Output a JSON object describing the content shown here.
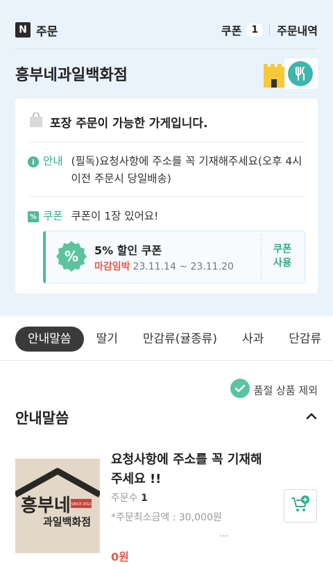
{
  "header": {
    "logo": "N",
    "title": "주문",
    "coupon_label": "쿠폰",
    "coupon_count": "1",
    "history_label": "주문내역"
  },
  "store": {
    "name": "흥부네과일백화점"
  },
  "notice_card": {
    "packaging_text": "포장 주문이 가능한 가게입니다.",
    "info_label": "안내",
    "info_text": "(필독)요청사항에 주소를 꼭 기재해주세요(오후 4시이전 주문시 당일배송)",
    "coupon_label": "쿠폰",
    "coupon_text": "쿠폰이 1장 있어요!"
  },
  "coupon": {
    "name": "5% 할인 쿠폰",
    "urgent": "마감임박",
    "dates": "23.11.14 ~ 23.11.20",
    "use_label_1": "쿠폰",
    "use_label_2": "사용"
  },
  "tabs": [
    "안내말씀",
    "딸기",
    "만감류(귤종류)",
    "사과",
    "단감류"
  ],
  "filter": {
    "soldout_label": "품절 상품 제외"
  },
  "section": {
    "title": "안내말씀"
  },
  "product": {
    "title_line1": "요청사항에 주소를 꼭 기재해",
    "title_line2": "주세요 !!",
    "orders_label": "주문수",
    "orders_value": "1",
    "min_order": "*주문최소금액 : 30,000원",
    "more": "...",
    "price": "0원",
    "thumb_text_1": "흥부네",
    "thumb_text_2": "과일백화점",
    "thumb_since": "SINCE 2012"
  },
  "colors": {
    "accent": "#2fae8e",
    "urgent": "#e45b4b",
    "bg_top": "#e9f3fb"
  }
}
